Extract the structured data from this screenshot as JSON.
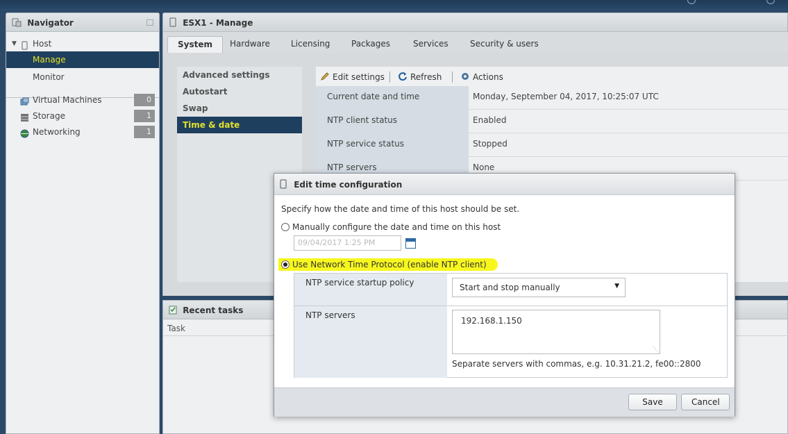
{
  "navigator": {
    "title": "Navigator",
    "items": [
      {
        "label": "Host"
      },
      {
        "label": "Manage"
      },
      {
        "label": "Monitor"
      },
      {
        "label": "Virtual Machines",
        "count": "0"
      },
      {
        "label": "Storage",
        "count": "1"
      },
      {
        "label": "Networking",
        "count": "1"
      }
    ]
  },
  "manage": {
    "title": "ESX1 - Manage",
    "tabs": [
      "System",
      "Hardware",
      "Licensing",
      "Packages",
      "Services",
      "Security & users"
    ],
    "side_menu": [
      "Advanced settings",
      "Autostart",
      "Swap",
      "Time & date"
    ],
    "toolbar": {
      "edit": "Edit settings",
      "refresh": "Refresh",
      "actions": "Actions"
    },
    "properties": [
      {
        "key": "Current date and time",
        "value": "Monday, September 04, 2017, 10:25:07 UTC"
      },
      {
        "key": "NTP client status",
        "value": "Enabled"
      },
      {
        "key": "NTP service status",
        "value": "Stopped"
      },
      {
        "key": "NTP servers",
        "value": "None"
      }
    ]
  },
  "tasks": {
    "title": "Recent tasks",
    "column_task": "Task"
  },
  "modal": {
    "title": "Edit time configuration",
    "description": "Specify how the date and time of this host should be set.",
    "manual_label": "Manually configure the date and time on this host",
    "date_value": "09/04/2017 1:25 PM",
    "ntp_label": "Use Network Time Protocol (enable NTP client)",
    "startup_policy_label": "NTP service startup policy",
    "startup_policy_value": "Start and stop manually",
    "ntp_servers_label": "NTP servers",
    "ntp_servers_value": "192.168.1.150",
    "hint": "Separate servers with commas, e.g. 10.31.21.2, fe00::2800",
    "save": "Save",
    "cancel": "Cancel"
  },
  "colors": {
    "selected_bg": "#1f3f61",
    "highlight": "#f7f71f"
  }
}
